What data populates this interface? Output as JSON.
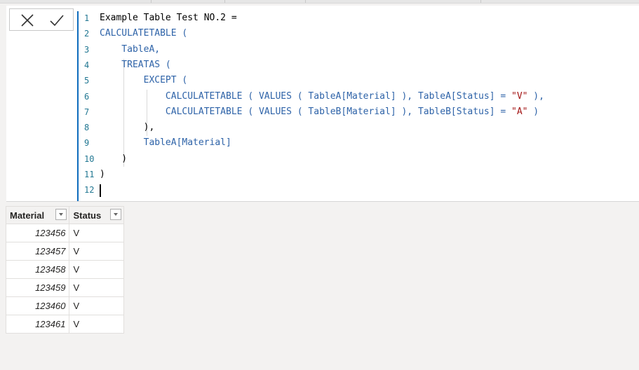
{
  "formula": {
    "cancel_icon": "close-icon",
    "commit_icon": "check-icon",
    "cursor_line": 12,
    "lines": [
      {
        "n": "1",
        "segments": [
          {
            "t": "Example Table Test NO.2 = ",
            "c": "plain"
          }
        ]
      },
      {
        "n": "2",
        "segments": [
          {
            "t": "CALCULATETABLE (",
            "c": "kw"
          }
        ]
      },
      {
        "n": "3",
        "segments": [
          {
            "t": "    TableA,",
            "c": "kw"
          }
        ]
      },
      {
        "n": "4",
        "segments": [
          {
            "t": "    TREATAS (",
            "c": "kw"
          }
        ]
      },
      {
        "n": "5",
        "segments": [
          {
            "t": "        EXCEPT (",
            "c": "kw"
          }
        ]
      },
      {
        "n": "6",
        "segments": [
          {
            "t": "            CALCULATETABLE ( VALUES ( TableA[Material] ), TableA[Status] = ",
            "c": "kw"
          },
          {
            "t": "\"V\"",
            "c": "str"
          },
          {
            "t": " ),",
            "c": "kw"
          }
        ]
      },
      {
        "n": "7",
        "segments": [
          {
            "t": "            CALCULATETABLE ( VALUES ( TableB[Material] ), TableB[Status] = ",
            "c": "kw"
          },
          {
            "t": "\"A\"",
            "c": "str"
          },
          {
            "t": " )",
            "c": "kw"
          }
        ]
      },
      {
        "n": "8",
        "segments": [
          {
            "t": "        ),",
            "c": "plain"
          }
        ]
      },
      {
        "n": "9",
        "segments": [
          {
            "t": "        TableA[Material]",
            "c": "kw"
          }
        ]
      },
      {
        "n": "10",
        "segments": [
          {
            "t": "    )",
            "c": "plain"
          }
        ]
      },
      {
        "n": "11",
        "segments": [
          {
            "t": ")",
            "c": "plain"
          }
        ]
      },
      {
        "n": "12",
        "segments": []
      }
    ]
  },
  "table": {
    "columns": [
      "Material",
      "Status"
    ],
    "rows": [
      [
        "123456",
        "V"
      ],
      [
        "123457",
        "V"
      ],
      [
        "123458",
        "V"
      ],
      [
        "123459",
        "V"
      ],
      [
        "123460",
        "V"
      ],
      [
        "123461",
        "V"
      ]
    ]
  }
}
